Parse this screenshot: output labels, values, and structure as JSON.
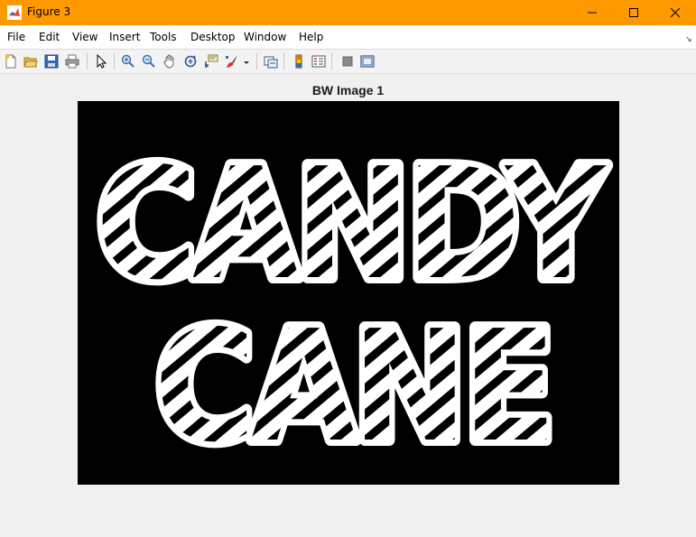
{
  "window": {
    "title": "Figure 3",
    "titlebar_color": "#ff9900",
    "buttons": [
      "minimize",
      "maximize",
      "close"
    ]
  },
  "menubar": {
    "items": [
      "File",
      "Edit",
      "View",
      "Insert",
      "Tools",
      "Desktop",
      "Window",
      "Help"
    ]
  },
  "toolbar": {
    "buttons": [
      "new-figure-icon",
      "open-file-icon",
      "save-icon",
      "print-icon",
      "edit-plot-icon",
      "zoom-in-icon",
      "zoom-out-icon",
      "pan-icon",
      "rotate-3d-icon",
      "data-cursor-icon",
      "brush-icon",
      "link-plot-icon",
      "insert-colorbar-icon",
      "insert-legend-icon",
      "hide-plot-tools-icon",
      "show-plot-tools-icon"
    ]
  },
  "axes": {
    "title": "BW Image 1",
    "image_text": "CANDY CANE"
  }
}
